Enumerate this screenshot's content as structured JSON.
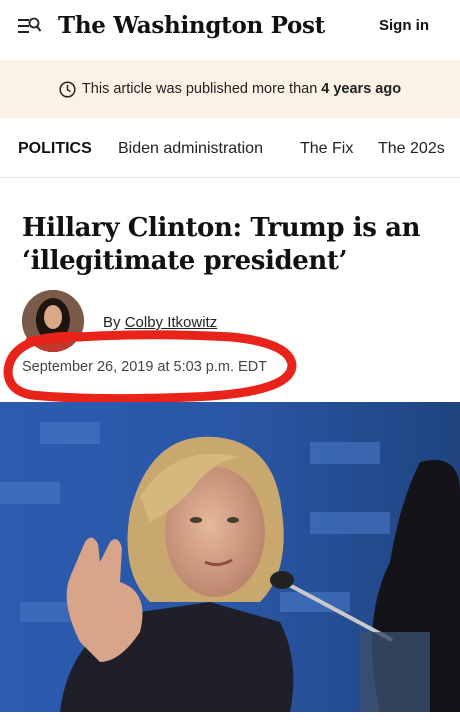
{
  "header": {
    "logo": "The Washington Post",
    "signin_label": "Sign in",
    "menu_icon": "menu-search-icon"
  },
  "notice": {
    "prefix": "This article was published more than",
    "emphasis": "4 years ago",
    "icon": "clock-icon"
  },
  "nav": {
    "items": [
      {
        "label": "POLITICS"
      },
      {
        "label": "Biden administration"
      },
      {
        "label": "The Fix"
      },
      {
        "label": "The 202s"
      }
    ]
  },
  "article": {
    "headline": "Hillary Clinton: Trump is an ‘illegitimate president’",
    "byline_prefix": "By",
    "author": "Colby Itkowitz",
    "date": "September 26, 2019 at 5:03 p.m. EDT"
  },
  "colors": {
    "notice_bg": "#fbf1e5",
    "annotation_red": "#e8231a",
    "photo_bg": "#2a5aa8"
  }
}
